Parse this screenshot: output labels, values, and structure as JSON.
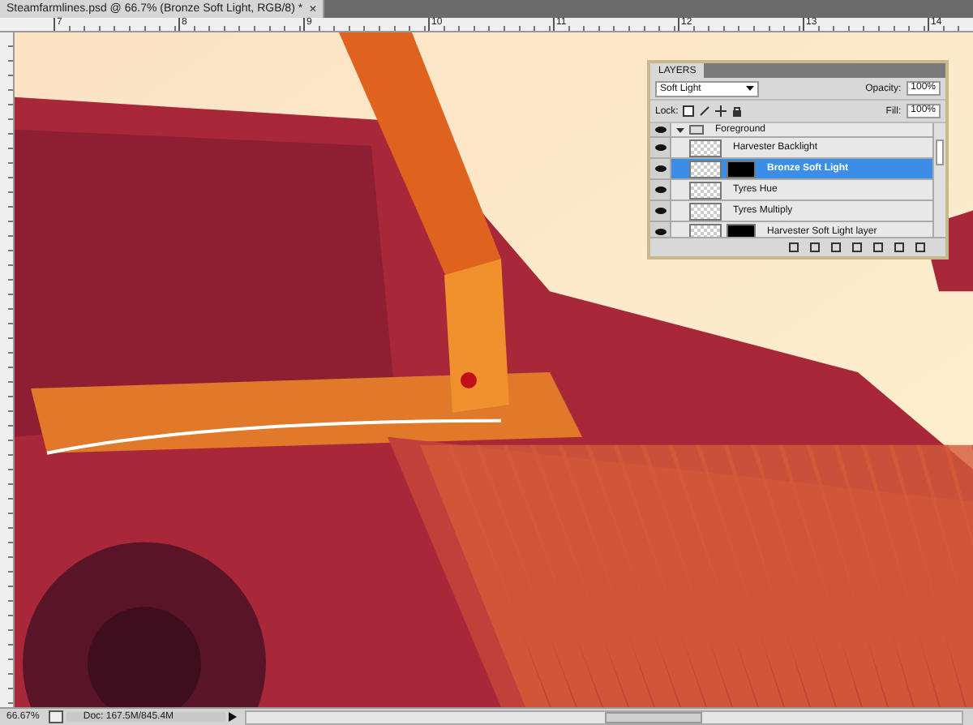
{
  "document_tab": {
    "title": "Steamfarmlines.psd @ 66.7% (Bronze Soft Light, RGB/8) *",
    "close": "×"
  },
  "ruler_labels": [
    "7",
    "8",
    "9",
    "10",
    "11",
    "12",
    "13",
    "14"
  ],
  "layers_panel": {
    "title": "LAYERS",
    "blend_mode": "Soft Light",
    "opacity_label": "Opacity:",
    "opacity": "100%",
    "lock_label": "Lock:",
    "fill_label": "Fill:",
    "fill": "100%",
    "layers": [
      {
        "kind": "group",
        "name": "Foreground",
        "visible": true,
        "selected": false,
        "mask": false
      },
      {
        "kind": "layer",
        "name": "Harvester Backlight",
        "visible": true,
        "selected": false,
        "mask": false
      },
      {
        "kind": "layer",
        "name": "Bronze Soft Light",
        "visible": true,
        "selected": true,
        "mask": true
      },
      {
        "kind": "layer",
        "name": "Tyres Hue",
        "visible": true,
        "selected": false,
        "mask": false
      },
      {
        "kind": "layer",
        "name": "Tyres Multiply",
        "visible": true,
        "selected": false,
        "mask": false
      },
      {
        "kind": "layer",
        "name": "Harvester Soft Light layer",
        "visible": true,
        "selected": false,
        "mask": true
      }
    ]
  },
  "status_bar": {
    "zoom": "66.67%",
    "doc_info": "Doc: 167.5M/845.4M"
  }
}
